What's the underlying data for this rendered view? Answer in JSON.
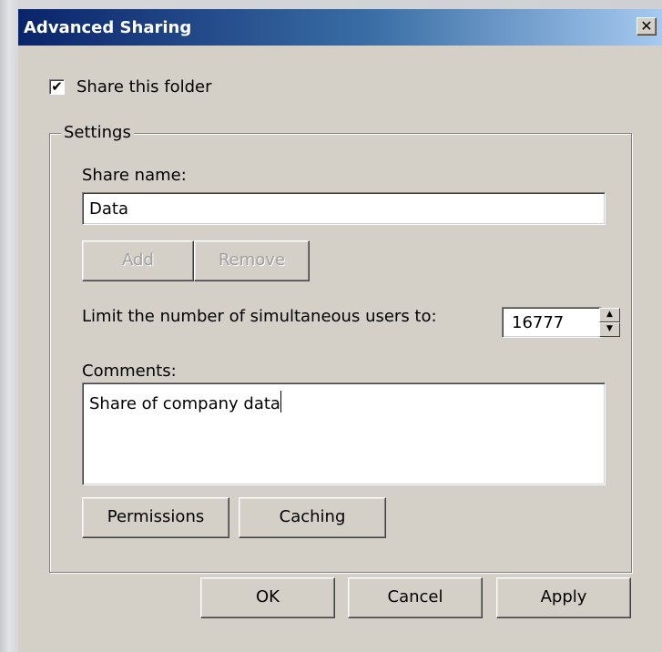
{
  "window": {
    "title": "Advanced Sharing",
    "close_glyph": "✕"
  },
  "share_folder": {
    "checked": true,
    "check_glyph": "✔",
    "label": "Share this folder"
  },
  "settings": {
    "group_label": "Settings",
    "share_name_label": "Share name:",
    "share_name_value": "Data",
    "add_label": "Add",
    "remove_label": "Remove",
    "limit_label": "Limit the number of simultaneous users to:",
    "limit_value": "16777",
    "comments_label": "Comments:",
    "comments_value": "Share of company data",
    "permissions_label": "Permissions",
    "caching_label": "Caching"
  },
  "footer": {
    "ok_label": "OK",
    "cancel_label": "Cancel",
    "apply_label": "Apply"
  }
}
